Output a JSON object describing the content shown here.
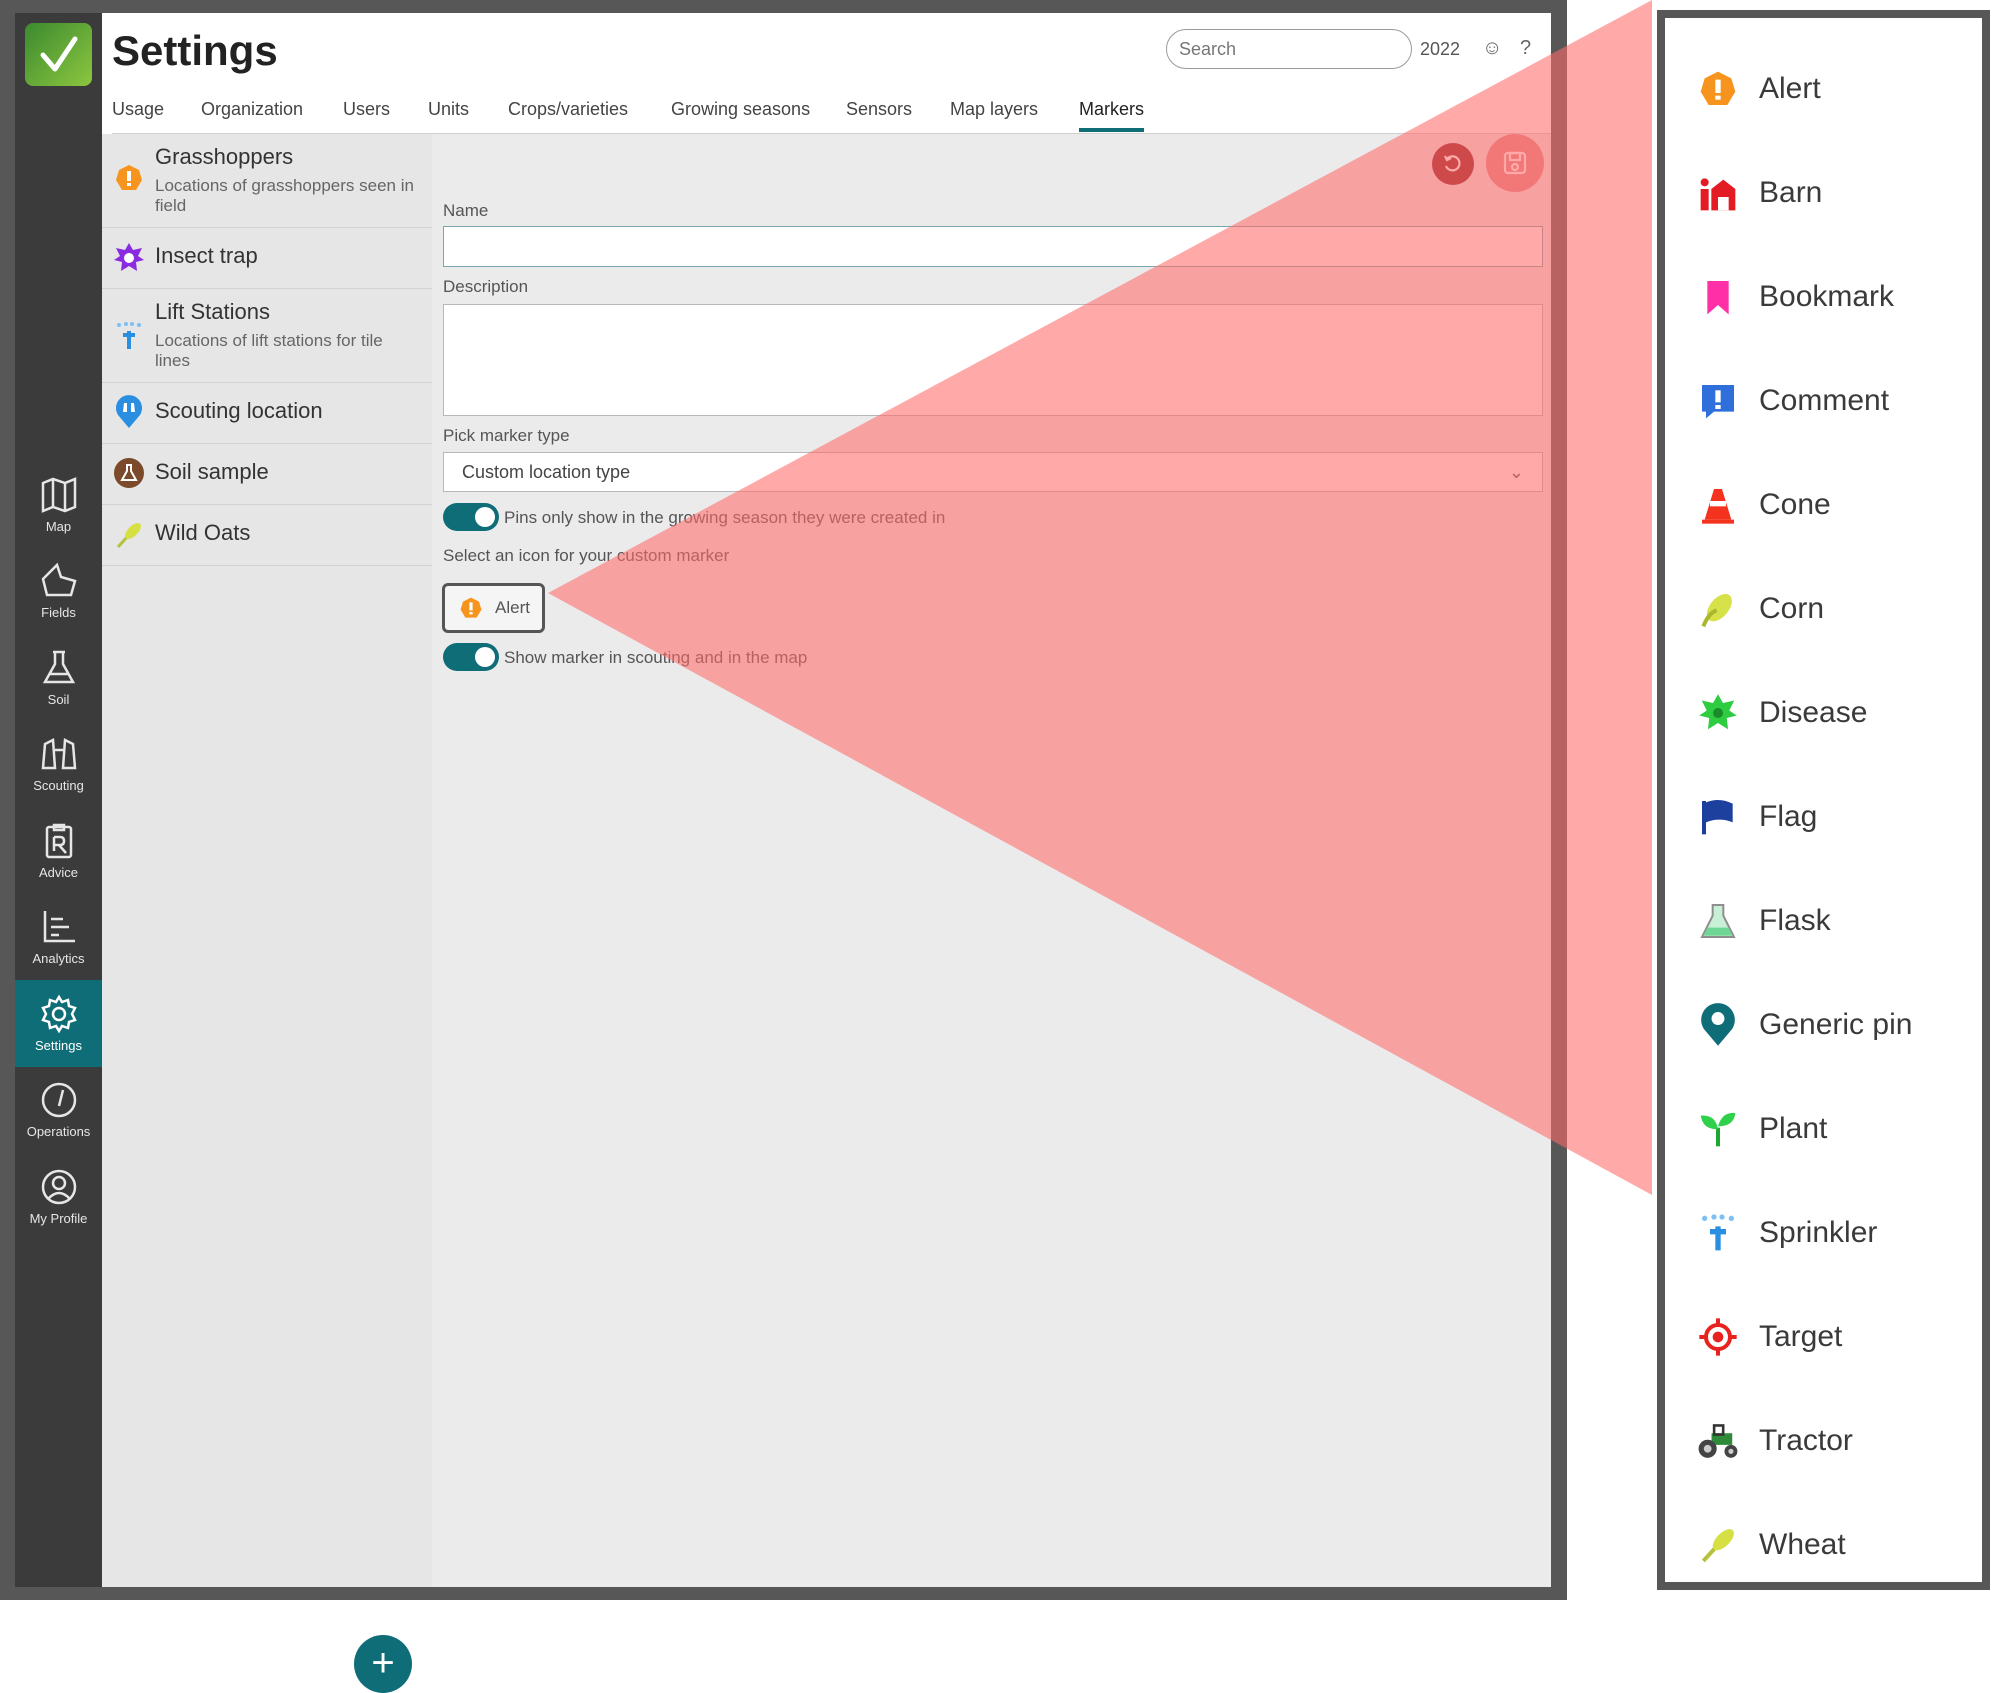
{
  "header": {
    "title": "Settings",
    "search_placeholder": "Search",
    "year": "2022",
    "help": "?"
  },
  "tabs": [
    "Usage",
    "Organization",
    "Users",
    "Units",
    "Crops/varieties",
    "Growing seasons",
    "Sensors",
    "Map layers",
    "Markers"
  ],
  "active_tab": "Markers",
  "nav": [
    {
      "label": "Map",
      "icon": "map-icon"
    },
    {
      "label": "Fields",
      "icon": "fields-icon"
    },
    {
      "label": "Soil",
      "icon": "flask-icon"
    },
    {
      "label": "Scouting",
      "icon": "binoculars-icon"
    },
    {
      "label": "Advice",
      "icon": "prescription-icon"
    },
    {
      "label": "Analytics",
      "icon": "chart-icon"
    },
    {
      "label": "Settings",
      "icon": "gear-icon",
      "active": true
    },
    {
      "label": "Operations",
      "icon": "gauge-icon"
    },
    {
      "label": "My Profile",
      "icon": "profile-icon"
    }
  ],
  "markers": [
    {
      "name": "Grasshoppers",
      "description": "Locations of grasshoppers seen in field",
      "icon": "alert-icon"
    },
    {
      "name": "Insect trap",
      "description": "",
      "icon": "disease-icon"
    },
    {
      "name": "Lift Stations",
      "description": "Locations of lift stations for tile lines",
      "icon": "sprinkler-icon"
    },
    {
      "name": "Scouting location",
      "description": "",
      "icon": "binoculars-pin-icon"
    },
    {
      "name": "Soil sample",
      "description": "",
      "icon": "flask-pin-icon"
    },
    {
      "name": "Wild Oats",
      "description": "",
      "icon": "wheat-icon"
    }
  ],
  "form": {
    "name_label": "Name",
    "name_value": "",
    "description_label": "Description",
    "description_value": "",
    "marker_type_label": "Pick marker type",
    "marker_type_value": "Custom location type",
    "pins_toggle_label": "Pins only show in the growing season they were created in",
    "icon_select_label": "Select an icon for your custom marker",
    "selected_icon": "Alert",
    "show_toggle_label": "Show marker in scouting and in the map"
  },
  "icon_options": [
    {
      "label": "Alert",
      "icon": "alert-icon",
      "color": "#f7941d"
    },
    {
      "label": "Barn",
      "icon": "barn-icon",
      "color": "#e31b23"
    },
    {
      "label": "Bookmark",
      "icon": "bookmark-icon",
      "color": "#ff2fa8"
    },
    {
      "label": "Comment",
      "icon": "comment-icon",
      "color": "#2f6fdc"
    },
    {
      "label": "Cone",
      "icon": "cone-icon",
      "color": "#f4331e"
    },
    {
      "label": "Corn",
      "icon": "corn-icon",
      "color": "#d7e24a"
    },
    {
      "label": "Disease",
      "icon": "disease-icon",
      "color": "#2ecc40"
    },
    {
      "label": "Flag",
      "icon": "flag-icon",
      "color": "#1d3f9e"
    },
    {
      "label": "Flask",
      "icon": "flask-icon",
      "color": "#8fe3b0"
    },
    {
      "label": "Generic pin",
      "icon": "pin-icon",
      "color": "#0f6d78"
    },
    {
      "label": "Plant",
      "icon": "plant-icon",
      "color": "#30d14a"
    },
    {
      "label": "Sprinkler",
      "icon": "sprinkler-icon",
      "color": "#2a8fe0"
    },
    {
      "label": "Target",
      "icon": "target-icon",
      "color": "#e8231f"
    },
    {
      "label": "Tractor",
      "icon": "tractor-icon",
      "color": "#2e8b3a"
    },
    {
      "label": "Wheat",
      "icon": "wheat-icon",
      "color": "#d6e043"
    }
  ],
  "colors": {
    "accent": "#0f6d78",
    "sidebar": "#3b3b3b",
    "overlay": "#ff6b6b"
  }
}
